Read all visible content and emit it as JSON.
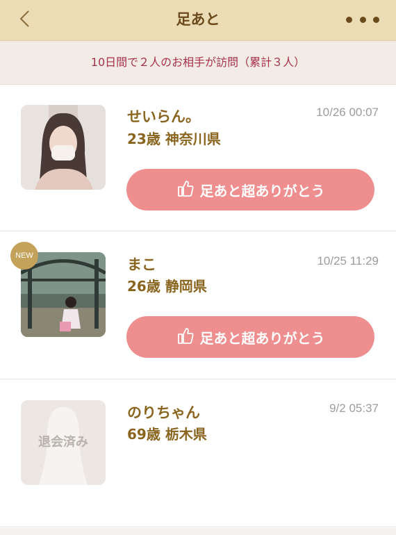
{
  "header": {
    "title": "足あと"
  },
  "summary": {
    "text": "10日間で２人のお相手が訪問（累計３人）"
  },
  "visitors": [
    {
      "name": "せいらん。",
      "age": "23歳",
      "prefecture": "神奈川県",
      "time": "10/26 00:07",
      "button_label": "足あと超ありがとう"
    },
    {
      "badge": "NEW",
      "name": "まこ",
      "age": "26歳",
      "prefecture": "静岡県",
      "time": "10/25 11:29",
      "button_label": "足あと超ありがとう"
    },
    {
      "name": "のりちゃん",
      "age": "69歳",
      "prefecture": "栃木県",
      "time": "9/2 05:37",
      "withdrawn_label": "退会済み"
    }
  ],
  "colors": {
    "header_bg": "#ecdcb6",
    "accent_brown": "#8a6520",
    "button_pink": "#ee8e8e",
    "summary_text": "#a8324a",
    "badge_gold": "#c4a25a"
  }
}
